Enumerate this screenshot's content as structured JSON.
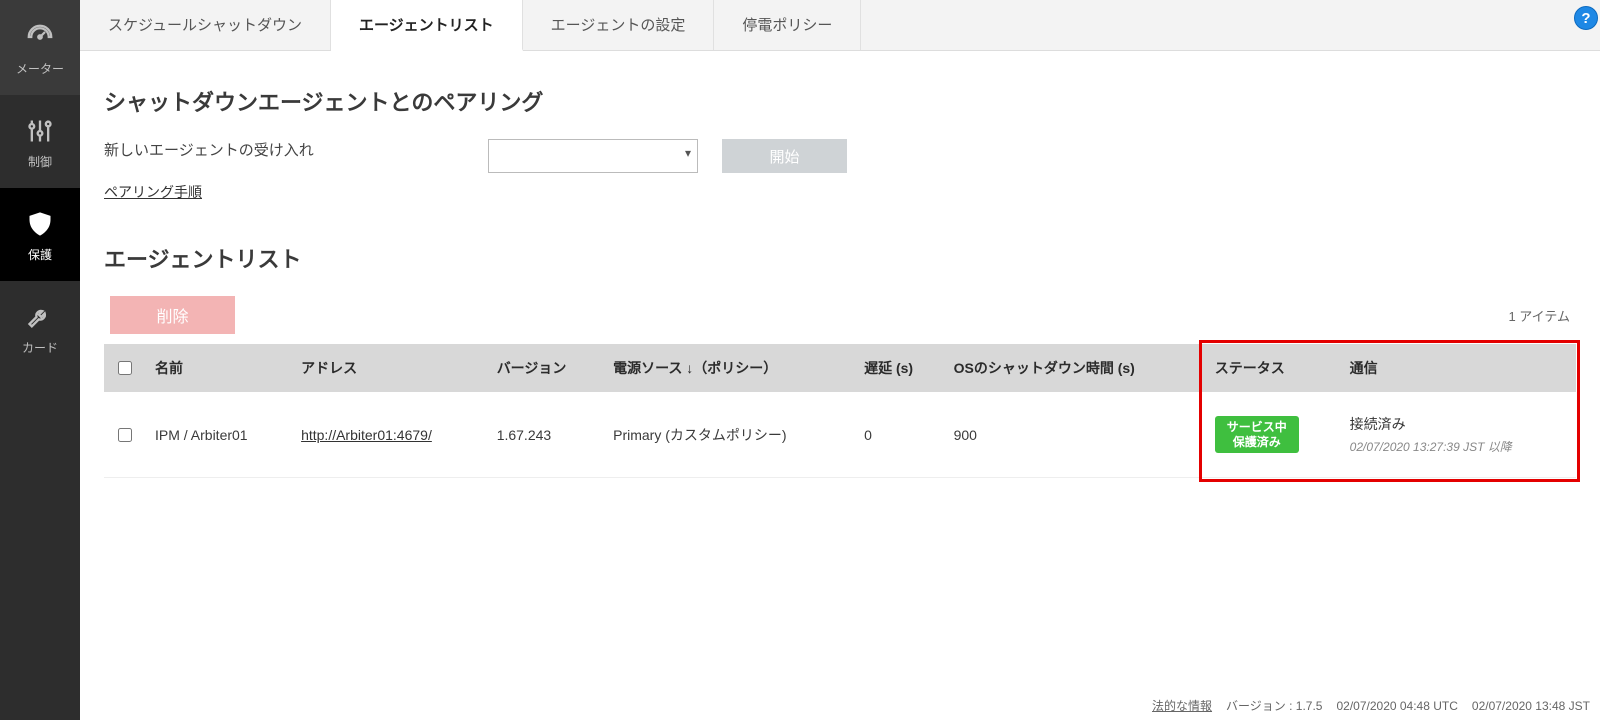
{
  "sidebar": {
    "items": [
      {
        "label": "メーター",
        "icon": "gauge"
      },
      {
        "label": "制御",
        "icon": "sliders"
      },
      {
        "label": "保護",
        "icon": "shield",
        "active": true
      },
      {
        "label": "カード",
        "icon": "wrench"
      }
    ]
  },
  "tabs": [
    {
      "label": "スケジュールシャットダウン"
    },
    {
      "label": "エージェントリスト",
      "active": true
    },
    {
      "label": "エージェントの設定"
    },
    {
      "label": "停電ポリシー"
    }
  ],
  "help_button": "?",
  "pairing": {
    "section_title": "シャットダウンエージェントとのペアリング",
    "accept_label": "新しいエージェントの受け入れ",
    "instructions_link": "ペアリング手順",
    "start_button": "開始"
  },
  "agent_list": {
    "section_title": "エージェントリスト",
    "delete_button": "削除",
    "item_count": "1 アイテム",
    "columns": {
      "name": "名前",
      "address": "アドレス",
      "version": "バージョン",
      "power_source": "電源ソース ↓（ポリシー）",
      "delay": "遅延 (s)",
      "os_shutdown": "OSのシャットダウン時間 (s)",
      "status": "ステータス",
      "communication": "通信"
    },
    "rows": [
      {
        "name": "IPM / Arbiter01",
        "address": "http://Arbiter01:4679/",
        "version": "1.67.243",
        "power_source": "Primary (カスタムポリシー)",
        "delay": "0",
        "os_shutdown": "900",
        "status_line1": "サービス中",
        "status_line2": "保護済み",
        "comm_main": "接続済み",
        "comm_sub": "02/07/2020 13:27:39 JST 以降"
      }
    ]
  },
  "footer": {
    "legal": "法的な情報",
    "version_label": "バージョン : 1.7.5",
    "utc": "02/07/2020 04:48 UTC",
    "local": "02/07/2020 13:48 JST"
  }
}
